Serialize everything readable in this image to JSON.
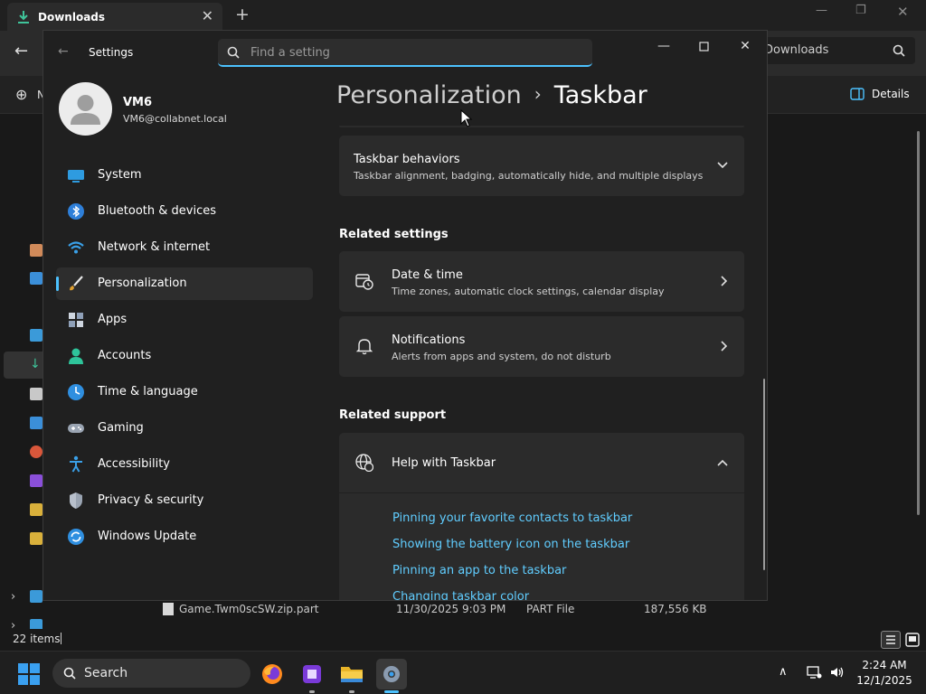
{
  "explorer": {
    "tab_title": "Downloads",
    "new_label": "N",
    "search_placeholder": "Downloads",
    "details_label": "Details",
    "status_items": "22 items",
    "file_row": {
      "name": "Game.Twm0scSW.zip.part",
      "date": "11/30/2025 9:03 PM",
      "type": "PART File",
      "size": "187,556 KB"
    }
  },
  "settings": {
    "window_title": "Settings",
    "search_placeholder": "Find a setting",
    "profile": {
      "name": "VM6",
      "email": "VM6@collabnet.local"
    },
    "nav": [
      {
        "label": "System",
        "icon": "system-icon"
      },
      {
        "label": "Bluetooth & devices",
        "icon": "bluetooth-icon"
      },
      {
        "label": "Network & internet",
        "icon": "wifi-icon"
      },
      {
        "label": "Personalization",
        "icon": "brush-icon",
        "selected": true
      },
      {
        "label": "Apps",
        "icon": "apps-icon"
      },
      {
        "label": "Accounts",
        "icon": "accounts-icon"
      },
      {
        "label": "Time & language",
        "icon": "time-language-icon"
      },
      {
        "label": "Gaming",
        "icon": "gamepad-icon"
      },
      {
        "label": "Accessibility",
        "icon": "accessibility-icon"
      },
      {
        "label": "Privacy & security",
        "icon": "shield-icon"
      },
      {
        "label": "Windows Update",
        "icon": "update-icon"
      }
    ],
    "breadcrumb": {
      "parent": "Personalization",
      "separator": "›",
      "current": "Taskbar"
    },
    "taskbar_behaviors": {
      "title": "Taskbar behaviors",
      "subtitle": "Taskbar alignment, badging, automatically hide, and multiple displays"
    },
    "related_settings": {
      "heading": "Related settings",
      "items": [
        {
          "title": "Date & time",
          "subtitle": "Time zones, automatic clock settings, calendar display"
        },
        {
          "title": "Notifications",
          "subtitle": "Alerts from apps and system, do not disturb"
        }
      ]
    },
    "related_support": {
      "heading": "Related support",
      "help_title": "Help with Taskbar",
      "links": [
        "Pinning your favorite contacts to taskbar",
        "Showing the battery icon on the taskbar",
        "Pinning an app to the taskbar",
        "Changing taskbar color"
      ]
    }
  },
  "taskbar": {
    "search_label": "Search",
    "apps": [
      "firefox-icon",
      "terminal-app-icon",
      "file-explorer-icon",
      "settings-gear-icon"
    ],
    "time": "2:24 AM",
    "date": "12/1/2025"
  },
  "colors": {
    "accent": "#4cc2ff",
    "link": "#60cdff",
    "window_bg": "#202020",
    "card_bg": "#2b2b2b"
  }
}
